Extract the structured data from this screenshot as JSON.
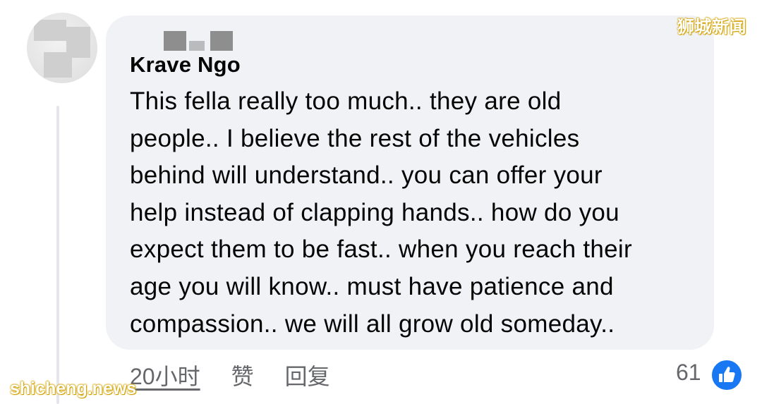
{
  "comment": {
    "author": "Krave Ngo",
    "lines": [
      "This fella really too much.. they are old",
      "people.. I believe the rest of the vehicles",
      "behind will understand.. you can offer your",
      "help instead of clapping hands.. how do you",
      "expect them to be fast.. when you reach their",
      "age you will know.. must have patience and",
      "compassion.. we will all grow old someday.."
    ],
    "timestamp": "20小时",
    "like_label": "赞",
    "reply_label": "回复",
    "reaction_count": "61",
    "reaction_icon": "thumbs-up-icon"
  },
  "watermarks": {
    "top": "狮城新闻",
    "bottom": "shicheng.news"
  },
  "colors": {
    "bubble": "#f0f2f5",
    "meta_text": "#65676b",
    "like_blue": "#1877f2",
    "watermark_outline": "#d1a200"
  }
}
